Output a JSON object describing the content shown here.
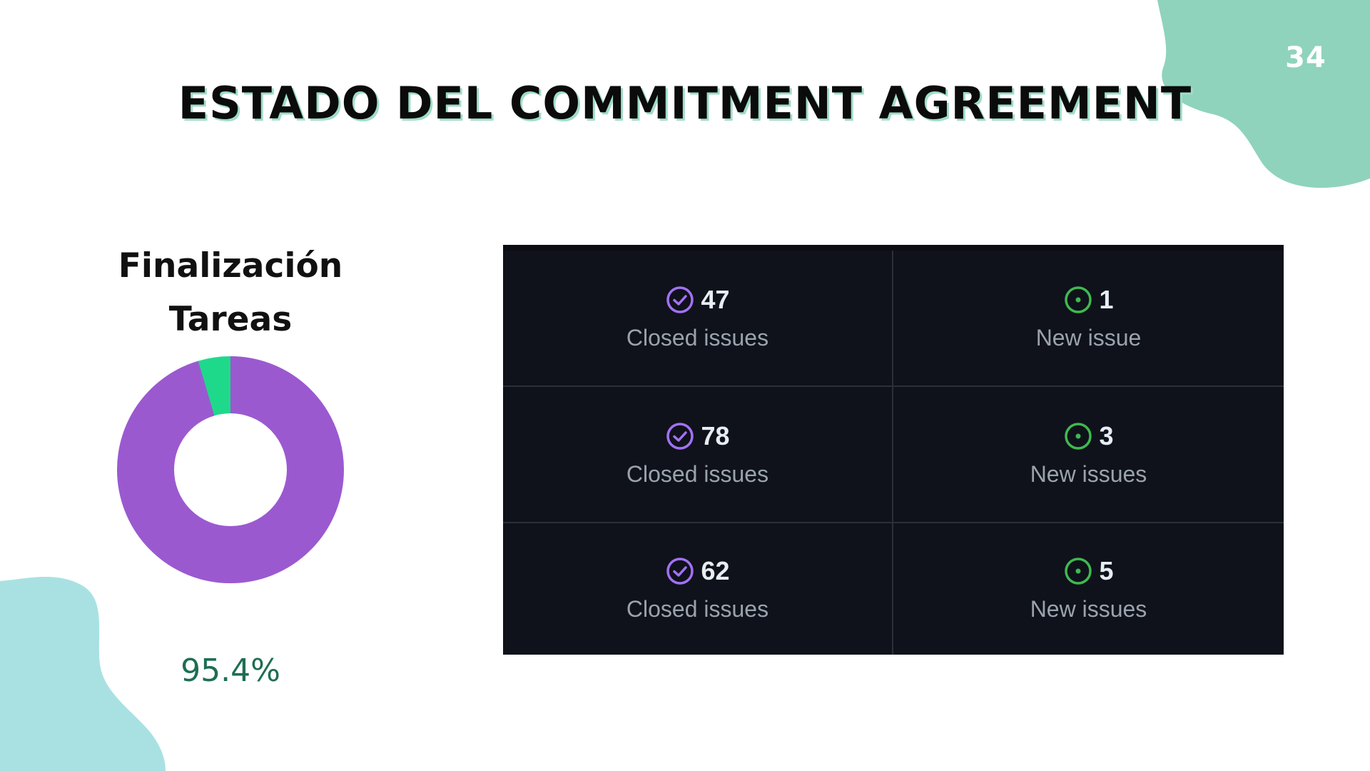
{
  "slide": {
    "page_number": "34",
    "title": "ESTADO DEL COMMITMENT AGREEMENT"
  },
  "donut": {
    "title_line1": "Finalización",
    "title_line2": "Tareas",
    "percent_label": "95.4%",
    "completed_fraction": 0.954,
    "colors": {
      "completed": "#9b59d0",
      "remaining": "#1fd98a"
    }
  },
  "stats": {
    "rows": [
      {
        "closed": {
          "count": "47",
          "label": "Closed issues"
        },
        "new": {
          "count": "1",
          "label": "New issue"
        }
      },
      {
        "closed": {
          "count": "78",
          "label": "Closed issues"
        },
        "new": {
          "count": "3",
          "label": "New issues"
        }
      },
      {
        "closed": {
          "count": "62",
          "label": "Closed issues"
        },
        "new": {
          "count": "5",
          "label": "New issues"
        }
      }
    ],
    "icons": {
      "closed": "check-circle-icon",
      "new": "issue-open-icon"
    },
    "colors": {
      "closed_icon": "#a371f7",
      "new_icon": "#3fb950",
      "panel_bg": "#0f121a"
    }
  },
  "theme": {
    "blob_top_right": "#8fd3bd",
    "blob_bottom_left": "#a9e1e3",
    "title_shadow": "#9fdcc9"
  }
}
